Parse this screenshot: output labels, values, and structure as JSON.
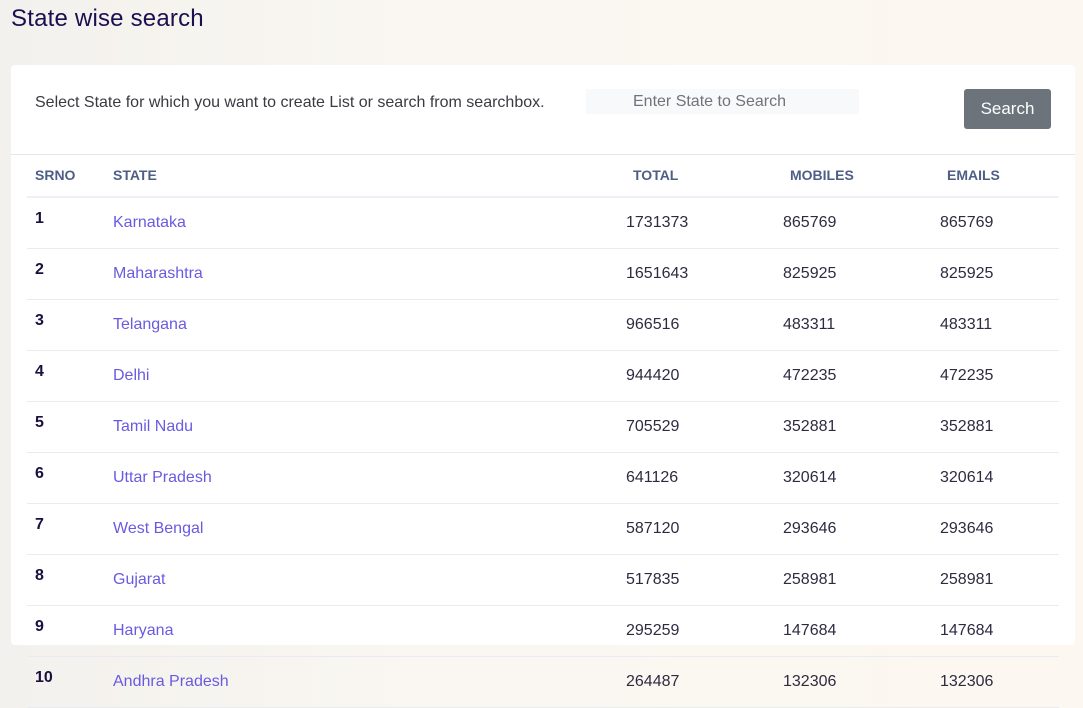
{
  "page": {
    "title": "State wise search"
  },
  "search": {
    "instruction": "Select State for which you want to create List or search from searchbox.",
    "placeholder": "Enter State to Search",
    "value": "",
    "button_label": "Search"
  },
  "table": {
    "columns": [
      "SRNO",
      "STATE",
      "TOTAL",
      "MOBILES",
      "EMAILS"
    ],
    "rows": [
      {
        "srno": "1",
        "state": "Karnataka",
        "total": "1731373",
        "mobiles": "865769",
        "emails": "865769"
      },
      {
        "srno": "2",
        "state": "Maharashtra",
        "total": "1651643",
        "mobiles": "825925",
        "emails": "825925"
      },
      {
        "srno": "3",
        "state": "Telangana",
        "total": "966516",
        "mobiles": "483311",
        "emails": "483311"
      },
      {
        "srno": "4",
        "state": "Delhi",
        "total": "944420",
        "mobiles": "472235",
        "emails": "472235"
      },
      {
        "srno": "5",
        "state": "Tamil Nadu",
        "total": "705529",
        "mobiles": "352881",
        "emails": "352881"
      },
      {
        "srno": "6",
        "state": "Uttar Pradesh",
        "total": "641126",
        "mobiles": "320614",
        "emails": "320614"
      },
      {
        "srno": "7",
        "state": "West Bengal",
        "total": "587120",
        "mobiles": "293646",
        "emails": "293646"
      },
      {
        "srno": "8",
        "state": "Gujarat",
        "total": "517835",
        "mobiles": "258981",
        "emails": "258981"
      },
      {
        "srno": "9",
        "state": "Haryana",
        "total": "295259",
        "mobiles": "147684",
        "emails": "147684"
      },
      {
        "srno": "10",
        "state": "Andhra Pradesh",
        "total": "264487",
        "mobiles": "132306",
        "emails": "132306"
      }
    ]
  },
  "colors": {
    "title": "#1a0f4f",
    "link": "#6a5ae0",
    "header_text": "#4e5f86",
    "button_bg": "#6c737b"
  }
}
